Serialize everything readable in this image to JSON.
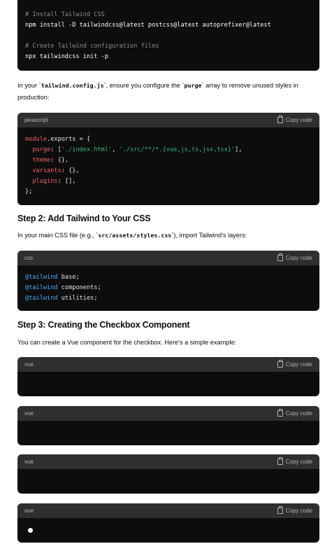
{
  "copy_label": "Copy code",
  "block1": {
    "line1": "# Install Tailwind CSS",
    "line2": "npm install -D tailwindcss@latest postcss@latest autoprefixer@latest",
    "line3": "# Create Tailwind configuration files",
    "line4": "npx tailwindcss init -p"
  },
  "para1": {
    "t1": "In your `",
    "c1": "tailwind.config.js",
    "t2": "`, ensure you configure the `",
    "c2": "purge",
    "t3": "` array to remove unused styles in production:"
  },
  "block2": {
    "lang": "javascript",
    "l1a": "module",
    "l1b": ".exports = {",
    "l2a": "  purge",
    "l2b": ": [",
    "l2c": "'./index.html'",
    "l2d": ", ",
    "l2e": "'./src/**/*.{vue,js,ts,jsx,tsx}'",
    "l2f": "],",
    "l3a": "  theme",
    "l3b": ": {},",
    "l4a": "  variants",
    "l4b": ": {},",
    "l5a": "  plugins",
    "l5b": ": [],",
    "l6": "};"
  },
  "step2": {
    "heading": "Step 2: Add Tailwind to Your CSS",
    "t1": "In your main CSS file (e.g., `",
    "c1": "src/assets/styles.css",
    "t2": "`), import Tailwind's layers:"
  },
  "block3": {
    "lang": "css",
    "l1a": "@tailwind",
    "l1b": " base;",
    "l2a": "@tailwind",
    "l2b": " components;",
    "l3a": "@tailwind",
    "l3b": " utilities;"
  },
  "step3": {
    "heading": "Step 3: Creating the Checkbox Component",
    "text": "You can create a Vue component for the checkbox. Here's a simple example:"
  },
  "vue_blocks": [
    {
      "lang": "vue"
    },
    {
      "lang": "vue"
    },
    {
      "lang": "vue"
    },
    {
      "lang": "vue"
    }
  ]
}
